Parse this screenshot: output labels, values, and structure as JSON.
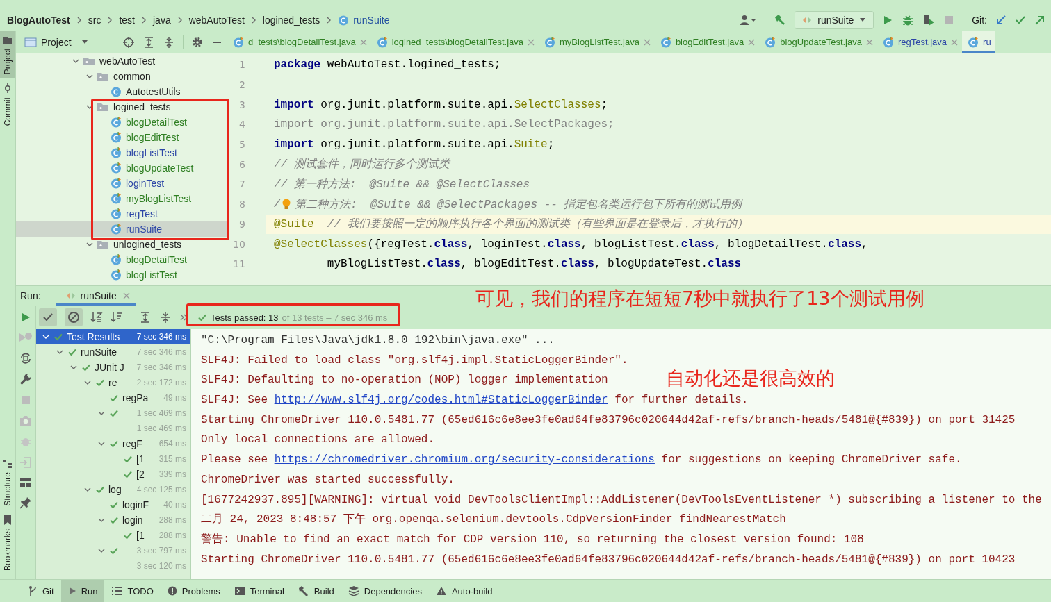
{
  "breadcrumb": [
    {
      "label": "BlogAutoTest",
      "kind": "project"
    },
    {
      "label": "src",
      "kind": "dir"
    },
    {
      "label": "test",
      "kind": "dir"
    },
    {
      "label": "java",
      "kind": "dir"
    },
    {
      "label": "webAutoTest",
      "kind": "dir"
    },
    {
      "label": "logined_tests",
      "kind": "dir"
    },
    {
      "label": "runSuite",
      "kind": "class"
    }
  ],
  "toolbar": {
    "run_config": "runSuite",
    "git_label": "Git:"
  },
  "project_panel": {
    "title": "Project",
    "tree": [
      {
        "name": "webAutoTest",
        "kind": "folder",
        "expanded": true,
        "selected": false,
        "children": [
          {
            "name": "common",
            "kind": "folder",
            "expanded": true,
            "selected": false,
            "children": [
              {
                "name": "AutotestUtils",
                "kind": "class",
                "color": "#222222",
                "selected": false
              }
            ]
          },
          {
            "name": "logined_tests",
            "kind": "folder",
            "expanded": true,
            "selected": false,
            "children": [
              {
                "name": "blogDetailTest",
                "kind": "test",
                "color": "#2f7f23",
                "selected": false
              },
              {
                "name": "blogEditTest",
                "kind": "test",
                "color": "#2f7f23",
                "selected": false
              },
              {
                "name": "blogListTest",
                "kind": "test",
                "color": "#2c46a6",
                "selected": false
              },
              {
                "name": "blogUpdateTest",
                "kind": "test",
                "color": "#2f7f23",
                "selected": false
              },
              {
                "name": "loginTest",
                "kind": "test",
                "color": "#2c46a6",
                "selected": false
              },
              {
                "name": "myBlogListTest",
                "kind": "test",
                "color": "#2f7f23",
                "selected": false
              },
              {
                "name": "regTest",
                "kind": "test",
                "color": "#2c46a6",
                "selected": false
              },
              {
                "name": "runSuite",
                "kind": "test",
                "color": "#2c46a6",
                "selected": true
              }
            ]
          },
          {
            "name": "unlogined_tests",
            "kind": "folder",
            "expanded": true,
            "selected": false,
            "children": [
              {
                "name": "blogDetailTest",
                "kind": "test",
                "color": "#2f7f23",
                "selected": false
              },
              {
                "name": "blogListTest",
                "kind": "test",
                "color": "#2f7f23",
                "selected": false
              }
            ]
          }
        ]
      }
    ]
  },
  "editor_tabs": [
    {
      "label": "d_tests\\blogDetailTest.java",
      "color": "#2f7f23",
      "selected": false
    },
    {
      "label": "logined_tests\\blogDetailTest.java",
      "color": "#2f7f23",
      "selected": false
    },
    {
      "label": "myBlogListTest.java",
      "color": "#2f7f23",
      "selected": false
    },
    {
      "label": "blogEditTest.java",
      "color": "#2f7f23",
      "selected": false
    },
    {
      "label": "blogUpdateTest.java",
      "color": "#2f7f23",
      "selected": false
    },
    {
      "label": "regTest.java",
      "color": "#2c46a6",
      "selected": false
    },
    {
      "label": "ru",
      "color": "#2c46a6",
      "selected": true
    }
  ],
  "editor": {
    "lines": [
      {
        "number": "1",
        "current": false,
        "segments": [
          {
            "kind": "kw",
            "text": "package"
          },
          {
            "kind": "plain",
            "text": " webAutoTest.logined_tests;"
          }
        ]
      },
      {
        "number": "2",
        "current": false
      },
      {
        "number": "3",
        "current": false,
        "segments": [
          {
            "kind": "kw",
            "text": "import"
          },
          {
            "kind": "plain",
            "text": " org.junit.platform.suite.api."
          },
          {
            "kind": "annot",
            "text": "SelectClasses"
          },
          {
            "kind": "plain",
            "text": ";"
          }
        ]
      },
      {
        "number": "4",
        "current": false,
        "segments": [
          {
            "kind": "unused",
            "text": "import org.junit.platform.suite.api.SelectPackages;"
          }
        ]
      },
      {
        "number": "5",
        "current": false,
        "segments": [
          {
            "kind": "kw",
            "text": "import"
          },
          {
            "kind": "plain",
            "text": " org.junit.platform.suite.api."
          },
          {
            "kind": "annot",
            "text": "Suite"
          },
          {
            "kind": "plain",
            "text": ";"
          }
        ]
      },
      {
        "number": "6",
        "current": false,
        "segments": [
          {
            "kind": "comment",
            "text": "// 测试套件，同时运行多个测试类"
          }
        ]
      },
      {
        "number": "7",
        "current": false,
        "segments": [
          {
            "kind": "comment",
            "text": "// 第一种方法:  @Suite && @SelectClasses"
          }
        ]
      },
      {
        "number": "8",
        "current": false,
        "segments": [
          {
            "kind": "comment",
            "text": "/"
          },
          {
            "kind": "bulb"
          },
          {
            "kind": "comment",
            "text": " 第二种方法:  @Suite && @SelectPackages -- 指定包名类运行包下所有的测试用例"
          }
        ]
      },
      {
        "number": "9",
        "current": true,
        "segments": [
          {
            "kind": "annot",
            "text": "@Suite"
          },
          {
            "kind": "comment",
            "text": "  // 我们要按照一定的顺序执行各个界面的测试类（有些界面是在登录后，才执行的）"
          }
        ]
      },
      {
        "number": "10",
        "current": false,
        "segments": [
          {
            "kind": "annot",
            "text": "@SelectClasses"
          },
          {
            "kind": "plain",
            "text": "({regTest."
          },
          {
            "kind": "kw",
            "text": "class"
          },
          {
            "kind": "plain",
            "text": ", loginTest."
          },
          {
            "kind": "kw",
            "text": "class"
          },
          {
            "kind": "plain",
            "text": ", blogListTest."
          },
          {
            "kind": "kw",
            "text": "class"
          },
          {
            "kind": "plain",
            "text": ", blogDetailTest."
          },
          {
            "kind": "kw",
            "text": "class"
          },
          {
            "kind": "plain",
            "text": ","
          }
        ]
      },
      {
        "number": "11",
        "current": false,
        "segments": [
          {
            "kind": "plain",
            "text": "        myBlogListTest."
          },
          {
            "kind": "kw",
            "text": "class"
          },
          {
            "kind": "plain",
            "text": ", blogEditTest."
          },
          {
            "kind": "kw",
            "text": "class"
          },
          {
            "kind": "plain",
            "text": ", blogUpdateTest."
          },
          {
            "kind": "kw",
            "text": "class"
          }
        ]
      }
    ]
  },
  "run_panel": {
    "label": "Run:",
    "tab": "runSuite",
    "summary": {
      "passed": "Tests passed: 13",
      "detail": "of 13 tests – 7 sec 346 ms"
    },
    "results": [
      {
        "name": "Test Results",
        "time": "7 sec 346 ms",
        "check": true,
        "selected": true,
        "expanded": true,
        "children": [
          {
            "name": "runSuite",
            "time": "7 sec 346 ms",
            "check": true,
            "selected": false,
            "expanded": true,
            "children": [
              {
                "name": "JUnit J",
                "time": "7 sec 346 ms",
                "check": true,
                "selected": false,
                "expanded": true,
                "children": [
                  {
                    "name": "re",
                    "time": "2 sec 172 ms",
                    "check": true,
                    "selected": false,
                    "expanded": true,
                    "children": [
                      {
                        "name": "regPa",
                        "time": "49 ms",
                        "check": true,
                        "selected": false
                      },
                      {
                        "time": "1 sec 469 ms",
                        "check": true,
                        "selected": false,
                        "expanded": true,
                        "children": [
                          {
                            "time": "1 sec 469 ms",
                            "check": false,
                            "selected": false
                          }
                        ]
                      },
                      {
                        "name": "regF",
                        "time": "654 ms",
                        "check": true,
                        "selected": false,
                        "expanded": true,
                        "children": [
                          {
                            "name": "[1",
                            "time": "315 ms",
                            "check": true,
                            "selected": false
                          },
                          {
                            "name": "[2",
                            "time": "339 ms",
                            "check": true,
                            "selected": false
                          }
                        ]
                      }
                    ]
                  },
                  {
                    "name": "log",
                    "time": "4 sec 125 ms",
                    "check": true,
                    "selected": false,
                    "expanded": true,
                    "children": [
                      {
                        "name": "loginF",
                        "time": "40 ms",
                        "check": true,
                        "selected": false
                      },
                      {
                        "name": "login",
                        "time": "288 ms",
                        "check": true,
                        "selected": false,
                        "expanded": true,
                        "children": [
                          {
                            "name": "[1",
                            "time": "288 ms",
                            "check": true,
                            "selected": false
                          }
                        ]
                      },
                      {
                        "time": "3 sec 797 ms",
                        "check": true,
                        "selected": false,
                        "expanded": true,
                        "children": [
                          {
                            "time": "3 sec 120 ms",
                            "check": false,
                            "selected": false
                          }
                        ]
                      }
                    ]
                  }
                ]
              }
            ]
          }
        ]
      }
    ],
    "console": [
      {
        "kind": "cmd",
        "segments": [
          {
            "text": "\"C:\\Program Files\\Java\\jdk1.8.0_192\\bin\\java.exe\" ...",
            "link": false
          }
        ]
      },
      {
        "kind": "err",
        "segments": [
          {
            "text": "SLF4J: Failed to load class \"org.slf4j.impl.StaticLoggerBinder\".",
            "link": false
          }
        ]
      },
      {
        "kind": "err",
        "segments": [
          {
            "text": "SLF4J: Defaulting to no-operation (NOP) logger implementation",
            "link": false
          }
        ]
      },
      {
        "kind": "err",
        "segments": [
          {
            "text": "SLF4J: See ",
            "link": false
          },
          {
            "text": "http://www.slf4j.org/codes.html#StaticLoggerBinder",
            "link": true
          },
          {
            "text": " for further details.",
            "link": false
          }
        ]
      },
      {
        "kind": "err",
        "segments": [
          {
            "text": "Starting ChromeDriver 110.0.5481.77 (65ed616c6e8ee3fe0ad64fe83796c020644d42af-refs/branch-heads/5481@{#839}) on port 31425",
            "link": false
          }
        ]
      },
      {
        "kind": "err",
        "segments": [
          {
            "text": "Only local connections are allowed.",
            "link": false
          }
        ]
      },
      {
        "kind": "err",
        "segments": [
          {
            "text": "Please see ",
            "link": false
          },
          {
            "text": "https://chromedriver.chromium.org/security-considerations",
            "link": true
          },
          {
            "text": " for suggestions on keeping ChromeDriver safe.",
            "link": false
          }
        ]
      },
      {
        "kind": "err",
        "segments": [
          {
            "text": "ChromeDriver was started successfully.",
            "link": false
          }
        ]
      },
      {
        "kind": "err",
        "segments": [
          {
            "text": "[1677242937.895][WARNING]: virtual void DevToolsClientImpl::AddListener(DevToolsEventListener *) subscribing a listener to the",
            "link": false
          }
        ]
      },
      {
        "kind": "err",
        "segments": [
          {
            "text": "二月 24, 2023 8:48:57 下午 org.openqa.selenium.devtools.CdpVersionFinder findNearestMatch",
            "link": false
          }
        ]
      },
      {
        "kind": "err",
        "segments": [
          {
            "text": "警告: Unable to find an exact match for CDP version 110, so returning the closest version found: 108",
            "link": false
          }
        ]
      },
      {
        "kind": "err",
        "segments": [
          {
            "text": "Starting ChromeDriver 110.0.5481.77 (65ed616c6e8ee3fe0ad64fe83796c020644d42af-refs/branch-heads/5481@{#839}) on port 10423",
            "link": false
          }
        ]
      }
    ]
  },
  "side_tabs": {
    "top": [
      {
        "label": "Project",
        "selected": true
      },
      {
        "label": "Commit",
        "selected": false
      }
    ],
    "bottom": [
      {
        "label": "Structure",
        "selected": false
      },
      {
        "label": "Bookmarks",
        "selected": false
      }
    ]
  },
  "bottom_tabs": [
    {
      "label": "Git",
      "selected": false
    },
    {
      "label": "Run",
      "selected": true
    },
    {
      "label": "TODO",
      "selected": false
    },
    {
      "label": "Problems",
      "selected": false
    },
    {
      "label": "Terminal",
      "selected": false
    },
    {
      "label": "Build",
      "selected": false
    },
    {
      "label": "Dependencies",
      "selected": false
    },
    {
      "label": "Auto-build",
      "selected": false
    }
  ],
  "annotations": [
    {
      "kind": "text",
      "text": "可见，我们的程序在短短7秒中就执行了13个测试用例"
    },
    {
      "kind": "text",
      "text": "自动化还是很高效的"
    },
    {
      "kind": "frame"
    },
    {
      "kind": "frame"
    }
  ]
}
